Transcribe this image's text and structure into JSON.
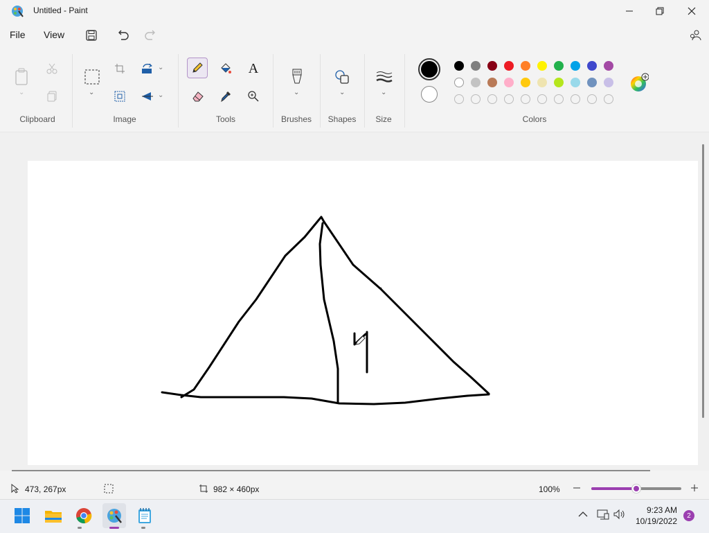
{
  "window": {
    "title": "Untitled - Paint",
    "controls": {
      "minimize": "minimize",
      "maximize": "restore",
      "close": "close"
    }
  },
  "menu": {
    "file": "File",
    "view": "View"
  },
  "ribbon": {
    "groups": {
      "clipboard": "Clipboard",
      "image": "Image",
      "tools": "Tools",
      "brushes": "Brushes",
      "shapes": "Shapes",
      "size": "Size",
      "colors": "Colors"
    },
    "text_tool_glyph": "A",
    "active_tool": "pencil",
    "primary_color": "#000000",
    "secondary_color": "#ffffff",
    "palette_row1": [
      "#000000",
      "#7f7f7f",
      "#880015",
      "#ed1c24",
      "#ff7f27",
      "#fff200",
      "#22b14c",
      "#00a2e8",
      "#3f48cc",
      "#a349a4"
    ],
    "palette_row2": [
      "#ffffff",
      "#c3c3c3",
      "#b97a57",
      "#ffaec9",
      "#ffc90e",
      "#efe4b0",
      "#b5e61d",
      "#99d9ea",
      "#7092be",
      "#c8bfe7"
    ],
    "palette_row3_empty_count": 10
  },
  "status": {
    "cursor_position": "473, 267px",
    "canvas_size": "982 × 460px",
    "zoom": "100%",
    "zoom_level": 0.5
  },
  "taskbar": {
    "time": "9:23 AM",
    "date": "10/19/2022",
    "notification_count": "2",
    "apps": [
      "start",
      "file-explorer",
      "chrome",
      "paint",
      "notepad"
    ]
  }
}
